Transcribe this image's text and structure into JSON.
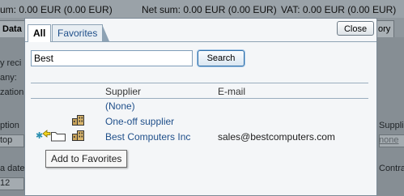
{
  "background": {
    "topbar": {
      "sum": "um:  0.00 EUR (0.00 EUR)",
      "net_sum": "Net sum:  0.00 EUR (0.00 EUR)",
      "vat": "VAT:  0.00 EUR (0.00 EUR)"
    },
    "tabs": {
      "left": "Data",
      "right": "ory"
    },
    "left_fragments": [
      "y reci",
      "any:",
      "zation",
      "ption",
      "top",
      "a date",
      "12"
    ],
    "right_fragments": [
      "Supplie",
      "none",
      "Contra"
    ]
  },
  "dialog": {
    "tabs": [
      {
        "label": "All"
      },
      {
        "label": "Favorites"
      }
    ],
    "close_label": "Close",
    "search": {
      "value": "Best",
      "button_label": "Search"
    },
    "columns": {
      "supplier": "Supplier",
      "email": "E-mail"
    },
    "rows": [
      {
        "supplier": "(None)",
        "email": ""
      },
      {
        "supplier": "One-off supplier",
        "email": ""
      },
      {
        "supplier": "Best Computers Inc",
        "email": "sales@bestcomputers.com"
      }
    ],
    "tooltip": "Add to Favorites"
  },
  "icons": {
    "row_icon": "building-icon",
    "favorite_icon": "star-icon",
    "add_favorite_icon": "add-to-favorites-folder-icon"
  }
}
